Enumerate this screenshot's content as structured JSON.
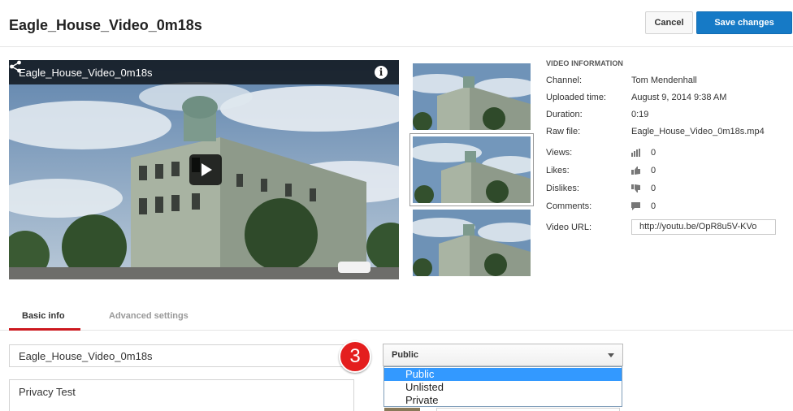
{
  "header": {
    "title": "Eagle_House_Video_0m18s",
    "cancel_label": "Cancel",
    "save_label": "Save changes"
  },
  "player": {
    "title": "Eagle_House_Video_0m18s",
    "icons": [
      "share-icon",
      "info-icon",
      "play-icon"
    ],
    "info_glyph": "i"
  },
  "video_info": {
    "heading": "VIDEO INFORMATION",
    "channel_label": "Channel:",
    "channel": "Tom Mendenhall",
    "uploaded_label": "Uploaded time:",
    "uploaded": "August 9, 2014 9:38 AM",
    "duration_label": "Duration:",
    "duration": "0:19",
    "raw_file_label": "Raw file:",
    "raw_file": "Eagle_House_Video_0m18s.mp4",
    "views_label": "Views:",
    "views": "0",
    "likes_label": "Likes:",
    "likes": "0",
    "dislikes_label": "Dislikes:",
    "dislikes": "0",
    "comments_label": "Comments:",
    "comments": "0",
    "url_label": "Video URL:",
    "url": "http://youtu.be/OpR8u5V-KVo"
  },
  "tabs": {
    "basic": "Basic info",
    "advanced": "Advanced settings"
  },
  "form": {
    "title_value": "Eagle_House_Video_0m18s",
    "description_value": "Privacy Test",
    "step_number": "3",
    "privacy_selected": "Public",
    "privacy_options": [
      "Public",
      "Unlisted",
      "Private"
    ]
  },
  "colors": {
    "accent": "#167ac6",
    "tab_underline": "#cc181e",
    "step_badge": "#e41e1e",
    "option_highlight": "#3399ff"
  }
}
